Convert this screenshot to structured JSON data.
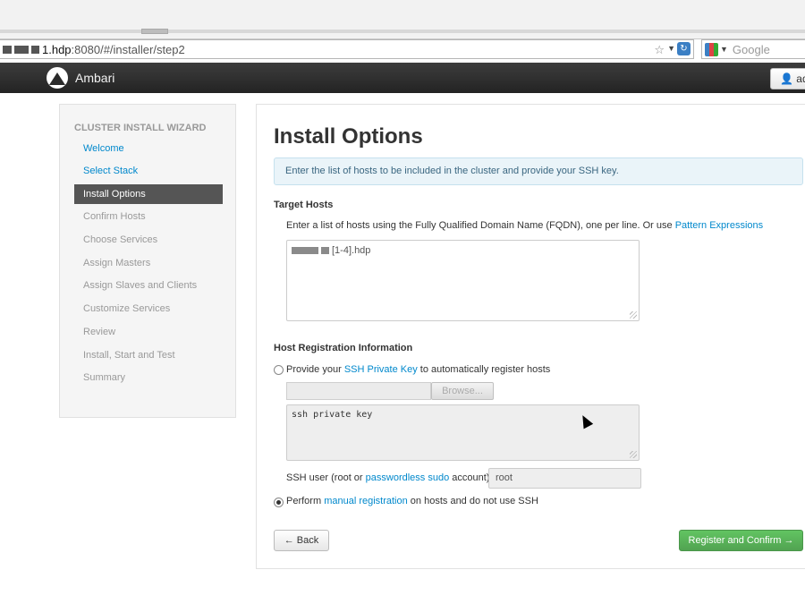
{
  "browser": {
    "url_host_suffix": "1.hdp",
    "url_rest": ":8080/#/installer/step2",
    "search_placeholder": "Google"
  },
  "navbar": {
    "brand": "Ambari",
    "user_label": "adr"
  },
  "sidebar": {
    "header": "CLUSTER INSTALL WIZARD",
    "items": [
      {
        "label": "Welcome",
        "state": "done"
      },
      {
        "label": "Select Stack",
        "state": "done"
      },
      {
        "label": "Install Options",
        "state": "active"
      },
      {
        "label": "Confirm Hosts",
        "state": "todo"
      },
      {
        "label": "Choose Services",
        "state": "todo"
      },
      {
        "label": "Assign Masters",
        "state": "todo"
      },
      {
        "label": "Assign Slaves and Clients",
        "state": "todo"
      },
      {
        "label": "Customize Services",
        "state": "todo"
      },
      {
        "label": "Review",
        "state": "todo"
      },
      {
        "label": "Install, Start and Test",
        "state": "todo"
      },
      {
        "label": "Summary",
        "state": "todo"
      }
    ]
  },
  "main": {
    "title": "Install Options",
    "info": "Enter the list of hosts to be included in the cluster and provide your SSH key.",
    "target_hosts": {
      "title": "Target Hosts",
      "help_prefix": "Enter a list of hosts using the Fully Qualified Domain Name (FQDN), one per line. Or use ",
      "help_link": "Pattern Expressions",
      "hosts_value_suffix": "[1-4].hdp"
    },
    "registration": {
      "title": "Host Registration Information",
      "ssh_option_prefix": "Provide your ",
      "ssh_option_link": "SSH Private Key",
      "ssh_option_suffix": " to automatically register hosts",
      "browse_label": "Browse...",
      "key_placeholder": "ssh private key",
      "ssh_user_prefix": "SSH user (root or ",
      "ssh_user_link": "passwordless sudo",
      "ssh_user_suffix": " account)",
      "ssh_user_value": "root",
      "manual_prefix": "Perform ",
      "manual_link": "manual registration",
      "manual_suffix": " on hosts and do not use SSH",
      "selected_option": "manual"
    },
    "back_label": "← Back",
    "confirm_label": "Register and Confirm →"
  },
  "colors": {
    "link": "#0088cc",
    "active_nav": "#555555",
    "confirm_green": "#5bb75b"
  }
}
